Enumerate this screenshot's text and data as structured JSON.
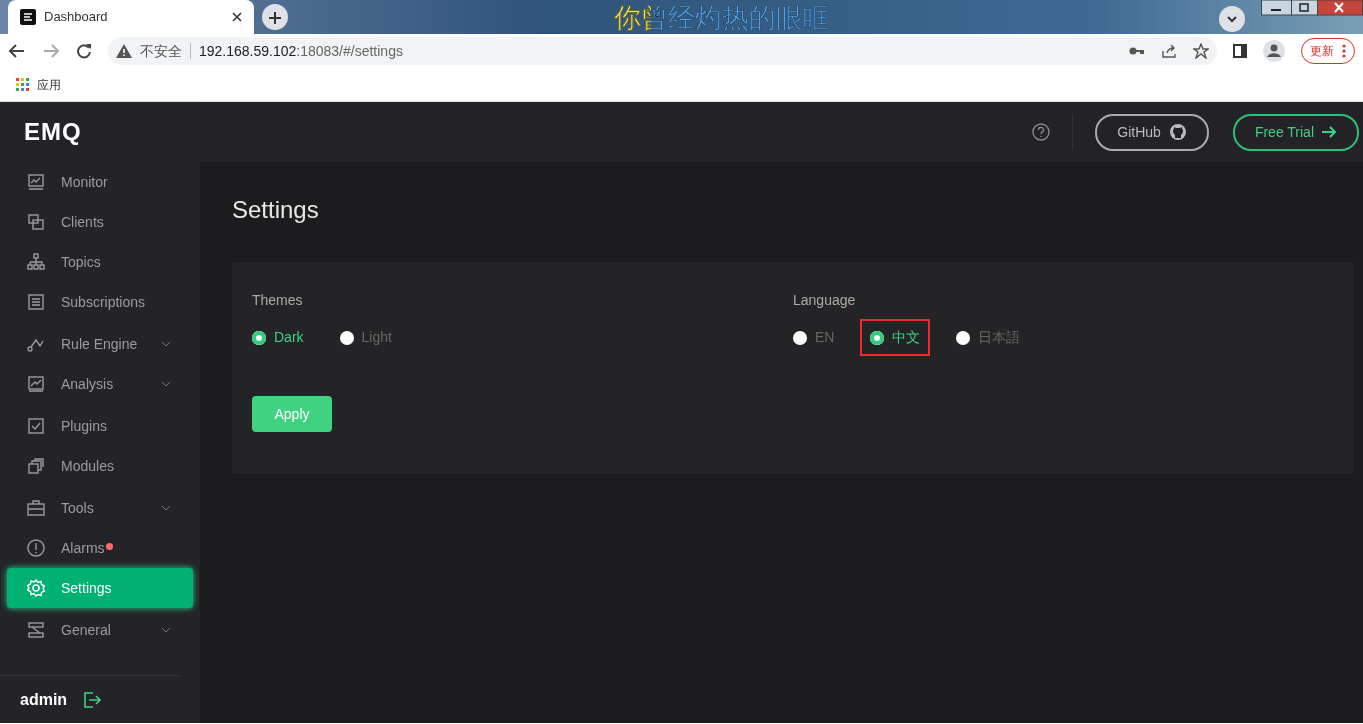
{
  "browser": {
    "tab_title": "Dashboard",
    "security": "不安全",
    "url_host": "192.168.59.102",
    "url_rest": ":18083/#/settings",
    "update_button": "更新",
    "bookmarks": [
      "应用"
    ]
  },
  "overlay_lyrics": "你曾经灼热的眼眶",
  "sidebar": {
    "logo": "EMQ",
    "items": [
      {
        "label": "Monitor",
        "selected": false,
        "expandable": false,
        "alert": false
      },
      {
        "label": "Clients",
        "selected": false,
        "expandable": false,
        "alert": false
      },
      {
        "label": "Topics",
        "selected": false,
        "expandable": false,
        "alert": false
      },
      {
        "label": "Subscriptions",
        "selected": false,
        "expandable": false,
        "alert": false
      },
      {
        "label": "Rule Engine",
        "selected": false,
        "expandable": true,
        "alert": false
      },
      {
        "label": "Analysis",
        "selected": false,
        "expandable": true,
        "alert": false
      },
      {
        "label": "Plugins",
        "selected": false,
        "expandable": false,
        "alert": false
      },
      {
        "label": "Modules",
        "selected": false,
        "expandable": false,
        "alert": false
      },
      {
        "label": "Tools",
        "selected": false,
        "expandable": true,
        "alert": false
      },
      {
        "label": "Alarms",
        "selected": false,
        "expandable": false,
        "alert": true
      },
      {
        "label": "Settings",
        "selected": true,
        "expandable": false,
        "alert": false
      },
      {
        "label": "General",
        "selected": false,
        "expandable": true,
        "alert": false
      }
    ],
    "user": "admin"
  },
  "header": {
    "github_button": "GitHub",
    "trial_button": "Free Trial"
  },
  "page": {
    "title": "Settings",
    "groups": [
      {
        "label": "Themes",
        "options": [
          {
            "label": "Dark",
            "selected": true,
            "highlighted": false
          },
          {
            "label": "Light",
            "selected": false,
            "highlighted": false
          }
        ]
      },
      {
        "label": "Language",
        "options": [
          {
            "label": "EN",
            "selected": false,
            "highlighted": false
          },
          {
            "label": "中文",
            "selected": true,
            "highlighted": true
          },
          {
            "label": "日本語",
            "selected": false,
            "highlighted": false
          }
        ]
      }
    ],
    "apply_button": "Apply"
  }
}
